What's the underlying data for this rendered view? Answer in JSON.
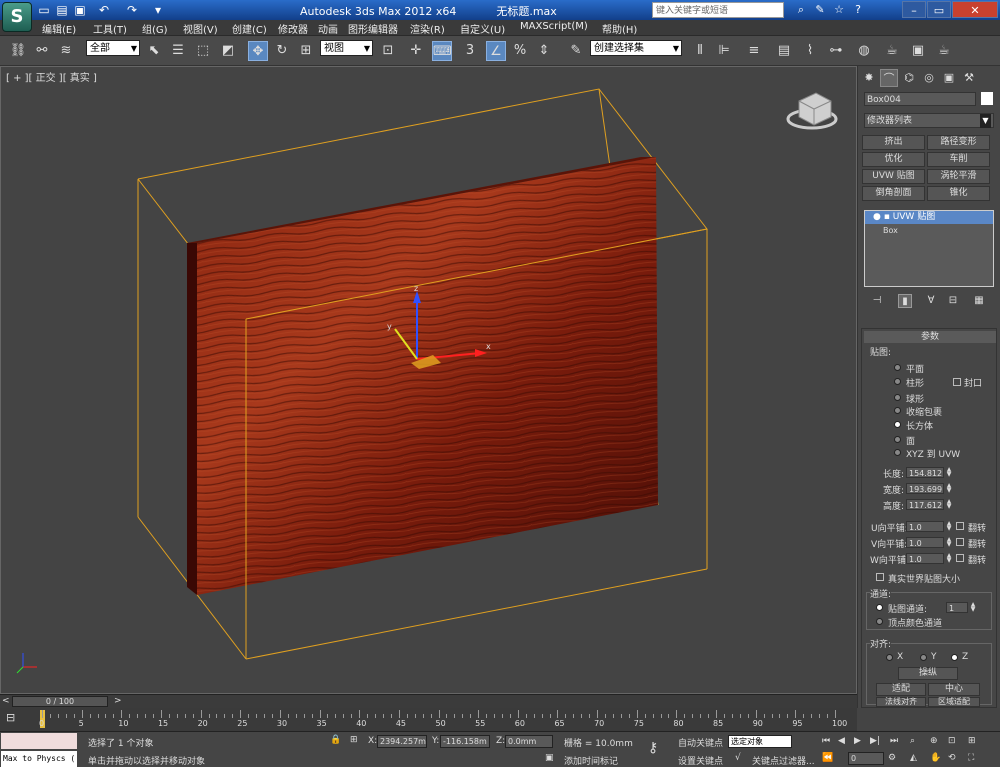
{
  "title": {
    "app": "Autodesk 3ds Max  2012 x64",
    "file": "无标题.max",
    "search_placeholder": "键入关键字或短语"
  },
  "app_logo": "S",
  "quick_access": [
    "undo-icon",
    "redo-icon"
  ],
  "menu": [
    "编辑(E)",
    "工具(T)",
    "组(G)",
    "视图(V)",
    "创建(C)",
    "修改器",
    "动画",
    "图形编辑器",
    "渲染(R)",
    "自定义(U)",
    "MAXScript(M)",
    "帮助(H)"
  ],
  "toolbar": {
    "filter": "全部",
    "ref_coord": "视图",
    "named_selection": "创建选择集"
  },
  "viewport": {
    "label": "[ + ][ 正交 ][ 真实 ]",
    "object_colors": {
      "bbox": "#e0a020",
      "wood_dark": "#4a0d06",
      "wood_light": "#a8391c"
    }
  },
  "panel": {
    "object_name": "Box004",
    "modifier_list": "修改器列表",
    "modifier_buttons": [
      "挤出",
      "路径变形",
      "优化",
      "车削",
      "UVW 贴图",
      "涡轮平滑",
      "倒角剖面",
      "锥化"
    ],
    "stack": {
      "top": "UVW 贴图",
      "sub": "Box"
    },
    "params_title": "参数",
    "mapping_label": "贴图:",
    "mapping_options": [
      "平面",
      "柱形",
      "球形",
      "收缩包裹",
      "长方体",
      "面",
      "XYZ 到 UVW"
    ],
    "mapping_selected": "长方体",
    "cap_label": "封口",
    "length_label": "长度:",
    "length": "154.812",
    "width_label": "宽度:",
    "width": "193.699",
    "height_label": "高度:",
    "height": "117.612",
    "u_tile_label": "U向平铺:",
    "u_tile": "1.0",
    "v_tile_label": "V向平铺:",
    "v_tile": "1.0",
    "w_tile_label": "W向平铺:",
    "w_tile": "1.0",
    "flip_label": "翻转",
    "real_world": "真实世界贴图大小",
    "channel_title": "通道:",
    "map_channel_label": "贴图通道:",
    "map_channel": "1",
    "vertex_color_channel": "顶点颜色通道",
    "alignment_title": "对齐:",
    "axis": [
      "X",
      "Y",
      "Z"
    ],
    "axis_selected": "Z",
    "manipulate": "操纵",
    "center": "中心",
    "fit": "适配",
    "fit_region": "区域适配",
    "normal_align": "法线对齐"
  },
  "timeline": {
    "frame": "0 / 100",
    "ticks": [
      "0",
      "5",
      "10",
      "15",
      "20",
      "25",
      "30",
      "35",
      "40",
      "45",
      "50",
      "55",
      "60",
      "65",
      "70",
      "75",
      "80",
      "85",
      "90",
      "95",
      "100"
    ]
  },
  "status": {
    "maxscript_line1": "",
    "maxscript_line2": "Max to Physcs (",
    "selected": "选择了 1 个对象",
    "prompt": "单击并拖动以选择并移动对象",
    "x_label": "X:",
    "x": "2394.257m",
    "y_label": "Y:",
    "y": "-116.158m",
    "z_label": "Z:",
    "z": "0.0mm",
    "grid": "栅格 = 10.0mm",
    "add_time_tag": "添加时间标记",
    "auto_key": "自动关键点",
    "selected_objects": "选定对象",
    "set_key": "设置关键点",
    "key_filters": "关键点过滤器...",
    "current_frame": "0"
  }
}
